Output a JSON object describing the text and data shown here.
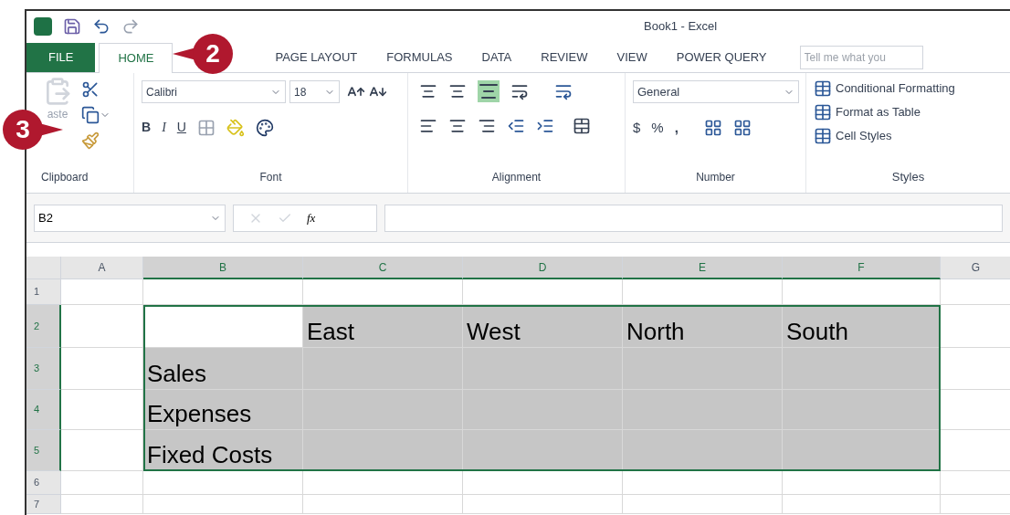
{
  "window": {
    "title": "Book1 - Excel"
  },
  "tabs": [
    {
      "label": "FILE",
      "kind": "file",
      "selected": false
    },
    {
      "label": "HOME",
      "kind": "tab",
      "selected": true
    },
    {
      "label": "PAGE LAYOUT",
      "kind": "tab",
      "selected": false
    },
    {
      "label": "FORMULAS",
      "kind": "tab",
      "selected": false
    },
    {
      "label": "DATA",
      "kind": "tab",
      "selected": false
    },
    {
      "label": "REVIEW",
      "kind": "tab",
      "selected": false
    },
    {
      "label": "VIEW",
      "kind": "tab",
      "selected": false
    },
    {
      "label": "POWER QUERY",
      "kind": "tab",
      "selected": false
    }
  ],
  "tell_me": {
    "placeholder": "Tell me what you"
  },
  "ribbon": {
    "clipboard": {
      "label": "Clipboard",
      "paste": "aste"
    },
    "font": {
      "label": "Font",
      "name": "Calibri",
      "size": "18",
      "bold": "B",
      "italic": "I",
      "underline": "U"
    },
    "alignment": {
      "label": "Alignment"
    },
    "number": {
      "label": "Number",
      "format": "General",
      "currency": "$",
      "percent": "%",
      "comma": ","
    },
    "styles": {
      "label": "Styles",
      "items": [
        "Conditional Formatting",
        "Format as Table",
        "Cell Styles"
      ]
    }
  },
  "formula_bar": {
    "name_box": "B2",
    "fx": "fx"
  },
  "columns": [
    {
      "label": "A",
      "selected": false
    },
    {
      "label": "B",
      "selected": true
    },
    {
      "label": "C",
      "selected": true
    },
    {
      "label": "D",
      "selected": true
    },
    {
      "label": "E",
      "selected": true
    },
    {
      "label": "F",
      "selected": true
    },
    {
      "label": "G",
      "selected": false
    }
  ],
  "rows": [
    {
      "number": "1",
      "selected": false,
      "cells": [
        {
          "selected": false
        },
        {
          "selected": false
        },
        {
          "selected": false
        },
        {
          "selected": false
        },
        {
          "selected": false
        },
        {
          "selected": false
        },
        {
          "selected": false
        }
      ]
    },
    {
      "number": "2",
      "selected": true,
      "cells": [
        {
          "selected": false
        },
        {
          "selected": false
        },
        {
          "text": "East",
          "selected": true
        },
        {
          "text": "West",
          "selected": true
        },
        {
          "text": "North",
          "selected": true
        },
        {
          "text": "South",
          "selected": true
        },
        {
          "selected": false
        }
      ]
    },
    {
      "number": "3",
      "selected": true,
      "cells": [
        {
          "selected": false
        },
        {
          "text": "Sales",
          "selected": true
        },
        {
          "selected": true
        },
        {
          "selected": true
        },
        {
          "selected": true
        },
        {
          "selected": true
        },
        {
          "selected": false
        }
      ]
    },
    {
      "number": "4",
      "selected": true,
      "cells": [
        {
          "selected": false
        },
        {
          "text": "Expenses",
          "selected": true
        },
        {
          "selected": true
        },
        {
          "selected": true
        },
        {
          "selected": true
        },
        {
          "selected": true
        },
        {
          "selected": false
        }
      ]
    },
    {
      "number": "5",
      "selected": true,
      "cells": [
        {
          "selected": false
        },
        {
          "text": "Fixed Costs",
          "selected": true
        },
        {
          "selected": true
        },
        {
          "selected": true
        },
        {
          "selected": true
        },
        {
          "selected": true
        },
        {
          "selected": false
        }
      ]
    },
    {
      "number": "6",
      "selected": false,
      "cells": [
        {
          "selected": false
        },
        {
          "selected": false
        },
        {
          "selected": false
        },
        {
          "selected": false
        },
        {
          "selected": false
        },
        {
          "selected": false
        },
        {
          "selected": false
        }
      ]
    },
    {
      "number": "7",
      "selected": false,
      "cells": [
        {
          "selected": false
        },
        {
          "selected": false
        },
        {
          "selected": false
        },
        {
          "selected": false
        },
        {
          "selected": false
        },
        {
          "selected": false
        },
        {
          "selected": false
        }
      ]
    }
  ],
  "callouts": [
    {
      "number": "2",
      "kind": "left"
    },
    {
      "number": "3",
      "kind": "right"
    }
  ]
}
